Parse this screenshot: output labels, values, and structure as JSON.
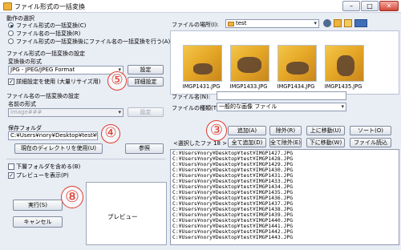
{
  "window": {
    "title": "ファイル形式の一括変換",
    "minimize": "–",
    "maximize": "□",
    "close": "✕"
  },
  "mode": {
    "section_label": "動作の選択",
    "options": [
      "ファイル形式の一括変換(C)",
      "ファイル名の一括変換(R)",
      "ファイル形式の一括変換後にファイル名の一括変換を行う(A)"
    ],
    "selected": 0
  },
  "format_settings": {
    "section_label": "ファイル形式の一括変換の設定",
    "format_label": "変換後の形式",
    "format_value": "JPG - JPEG/JPEG Format",
    "settings_button": "設定",
    "advanced_checkbox": "詳細設定を使用 (大量リサイズ用)",
    "advanced_button": "詳細設定"
  },
  "rename_settings": {
    "section_label": "ファイル名の一括変換の設定",
    "name_format_label": "名前の形式",
    "name_format_value": "image###",
    "settings_button": "設定"
  },
  "output": {
    "folder_label": "保存フォルダ",
    "folder_value": "C:¥Users¥nory¥Desktop¥test¥trans¥",
    "use_current_button": "現在のディレクトリを使用(U)",
    "browse_button": "参照"
  },
  "options": {
    "subfolders": "下層フォルダを含める(B)",
    "show_preview": "プレビューを表示(P)"
  },
  "actions": {
    "run_button": "実行(S)",
    "cancel_button": "キャンセル",
    "preview_label": "プレビュー"
  },
  "annotations": [
    "⑤",
    "④",
    "③",
    "⑧"
  ],
  "browser": {
    "location_label": "ファイルの場所(I):",
    "location_value": "test",
    "thumbnails": [
      "IMGP1431.JPG",
      "IMGP1433.JPG",
      "IMGP1434.JPG",
      "IMGP1435.JPG"
    ],
    "filename_label": "ファイル名(N):",
    "filename_value": "",
    "filetype_label": "ファイルの種類(T):",
    "filetype_value": "一般的な画像 ファイル"
  },
  "selection": {
    "add_button": "追加(A)",
    "remove_button": "除外(R)",
    "move_up_button": "上に移動(U)",
    "sort_button": "ソート(O)",
    "list_label": "<選択したファ 18 >",
    "add_all_button": "全て追加(D)",
    "remove_all_button": "全て除外(E)",
    "move_down_button": "下に移動(W)",
    "load_file_button": "ファイル読込",
    "files": [
      "C:¥Users¥nory¥Desktop¥test¥IMGP1427.JPG",
      "C:¥Users¥nory¥Desktop¥test¥IMGP1428.JPG",
      "C:¥Users¥nory¥Desktop¥test¥IMGP1429.JPG",
      "C:¥Users¥nory¥Desktop¥test¥IMGP1430.JPG",
      "C:¥Users¥nory¥Desktop¥test¥IMGP1431.JPG",
      "C:¥Users¥nory¥Desktop¥test¥IMGP1433.JPG",
      "C:¥Users¥nory¥Desktop¥test¥IMGP1434.JPG",
      "C:¥Users¥nory¥Desktop¥test¥IMGP1435.JPG",
      "C:¥Users¥nory¥Desktop¥test¥IMGP1436.JPG",
      "C:¥Users¥nory¥Desktop¥test¥IMGP1437.JPG",
      "C:¥Users¥nory¥Desktop¥test¥IMGP1438.JPG",
      "C:¥Users¥nory¥Desktop¥test¥IMGP1439.JPG",
      "C:¥Users¥nory¥Desktop¥test¥IMGP1440.JPG",
      "C:¥Users¥nory¥Desktop¥test¥IMGP1441.JPG",
      "C:¥Users¥nory¥Desktop¥test¥IMGP1442.JPG",
      "C:¥Users¥nory¥Desktop¥test¥IMGP1443.JPG"
    ]
  },
  "colors": {
    "annotation": "#e23b2e",
    "folder": "#f0b23c"
  }
}
